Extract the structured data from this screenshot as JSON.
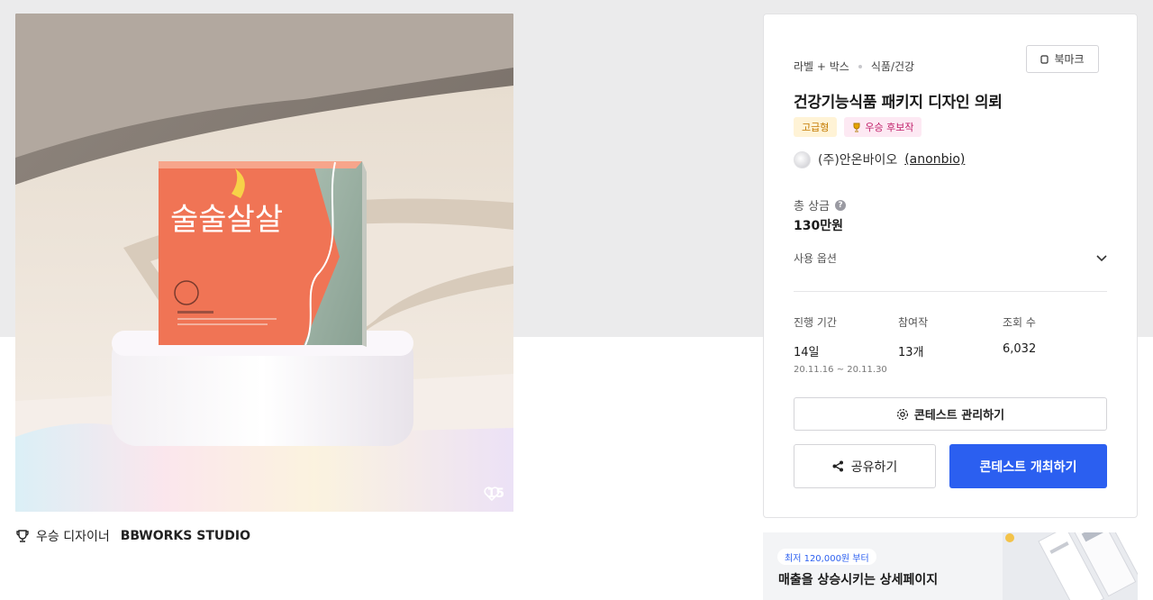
{
  "hero": {
    "product_text_main": "술술살살",
    "likes": "15"
  },
  "designer": {
    "prefix": "우승 디자이너",
    "name": "BBWORKS STUDIO"
  },
  "card": {
    "bookmark_label": "북마크",
    "breadcrumb": [
      "라벨 + 박스",
      "식품/건강"
    ],
    "title": "건강기능식품 패키지 디자인 의뢰",
    "badges": {
      "grade": "고급형",
      "award": "우승 후보작"
    },
    "company": {
      "name": "(주)안온바이오",
      "handle": "(anonbio)"
    },
    "prize": {
      "label": "총 상금",
      "help": "?",
      "value": "130만원"
    },
    "options_label": "사용 옵션",
    "stats": {
      "period_label": "진행 기간",
      "period_value": "14일",
      "period_range": "20.11.16 ~ 20.11.30",
      "participants_label": "참여작",
      "participants_value": "13개",
      "views_label": "조회 수",
      "views_value": "6,032"
    },
    "manage_label": "콘테스트 관리하기",
    "share_label": "공유하기",
    "host_label": "콘테스트 개최하기"
  },
  "ad": {
    "pill": "최저 120,000원 부터",
    "headline": "매출을 상승시키는 상세페이지"
  },
  "colors": {
    "accent": "#2b5ff0",
    "grade_badge_bg": "#fff3d6",
    "award_badge_bg": "#fde9f3",
    "box_coral": "#f07455",
    "box_sage": "#9fb5a5"
  }
}
